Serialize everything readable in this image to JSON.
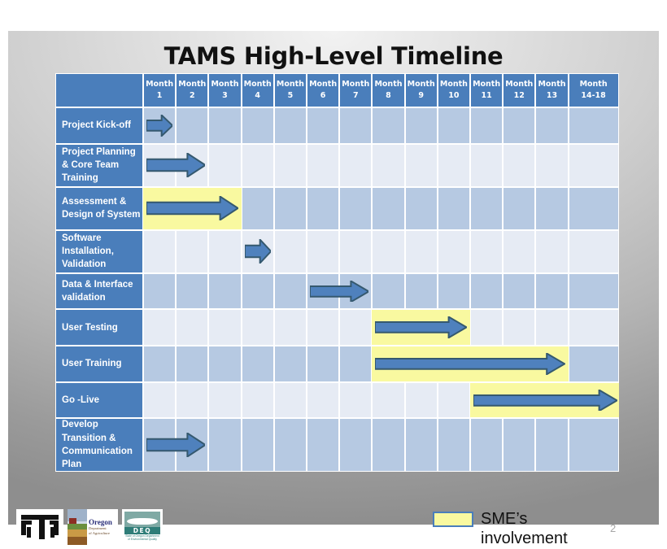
{
  "slide": {
    "title": "TAMS High-Level Timeline",
    "slide_number": "2"
  },
  "legend": {
    "swatch_color": "#f9f9a0",
    "swatch_border_color": "#4a7ebb",
    "line1": "SME’s",
    "line2": "involvement"
  },
  "logos": {
    "oda_line1": "Oregon",
    "oda_line2": "Department",
    "oda_line3": "of Agriculture",
    "deq_label": "DEQ",
    "deq_sub": "State of Oregon Department of Environmental Quality"
  },
  "chart_data": {
    "type": "table",
    "title": "TAMS High-Level Timeline",
    "corner_header": "",
    "columns": [
      {
        "label_line1": "Month",
        "label_line2": "1"
      },
      {
        "label_line1": "Month",
        "label_line2": "2"
      },
      {
        "label_line1": "Month",
        "label_line2": "3"
      },
      {
        "label_line1": "Month",
        "label_line2": "4"
      },
      {
        "label_line1": "Month",
        "label_line2": "5"
      },
      {
        "label_line1": "Month",
        "label_line2": "6"
      },
      {
        "label_line1": "Month",
        "label_line2": "7"
      },
      {
        "label_line1": "Month",
        "label_line2": "8"
      },
      {
        "label_line1": "Month",
        "label_line2": "9"
      },
      {
        "label_line1": "Month",
        "label_line2": "10"
      },
      {
        "label_line1": "Month",
        "label_line2": "11"
      },
      {
        "label_line1": "Month",
        "label_line2": "12"
      },
      {
        "label_line1": "Month",
        "label_line2": "13"
      },
      {
        "label_line1": "Month",
        "label_line2": "14-18"
      }
    ],
    "rows": [
      {
        "label": "Project Kick-off",
        "stripe": "a",
        "bar_start_month": 1,
        "bar_end_month": 1,
        "sme": false
      },
      {
        "label": "Project Planning & Core Team Training",
        "stripe": "b",
        "bar_start_month": 1,
        "bar_end_month": 2,
        "sme": false
      },
      {
        "label": "Assessment & Design of System",
        "stripe": "a",
        "bar_start_month": 1,
        "bar_end_month": 3,
        "sme": true,
        "sme_start_month": 1,
        "sme_end_month": 3
      },
      {
        "label": "Software Installation, Validation",
        "stripe": "b",
        "bar_start_month": 4,
        "bar_end_month": 4,
        "sme": false
      },
      {
        "label": "Data & Interface validation",
        "stripe": "a",
        "bar_start_month": 6,
        "bar_end_month": 7,
        "sme": false
      },
      {
        "label": "User Testing",
        "stripe": "b",
        "bar_start_month": 8,
        "bar_end_month": 10,
        "sme": true,
        "sme_start_month": 8,
        "sme_end_month": 10
      },
      {
        "label": "User Training",
        "stripe": "a",
        "bar_start_month": 8,
        "bar_end_month": 13,
        "sme": true,
        "sme_start_month": 8,
        "sme_end_month": 13
      },
      {
        "label": "Go -Live",
        "stripe": "b",
        "bar_start_month": 11,
        "bar_end_month": 14,
        "sme": true,
        "sme_start_month": 11,
        "sme_end_month": 14
      },
      {
        "label": "Develop Transition & Communication Plan",
        "stripe": "a",
        "bar_start_month": 1,
        "bar_end_month": 2,
        "sme": false
      }
    ],
    "colors": {
      "header_blue": "#4a7ebb",
      "stripe_a": "#b6c9e2",
      "stripe_b": "#e6ebf4",
      "arrow_fill": "#4f81bd",
      "arrow_stroke": "#35596f",
      "sme_yellow": "#f9f9a0"
    },
    "legend_entries": [
      {
        "color": "#f9f9a0",
        "label": "SME’s involvement"
      }
    ]
  }
}
